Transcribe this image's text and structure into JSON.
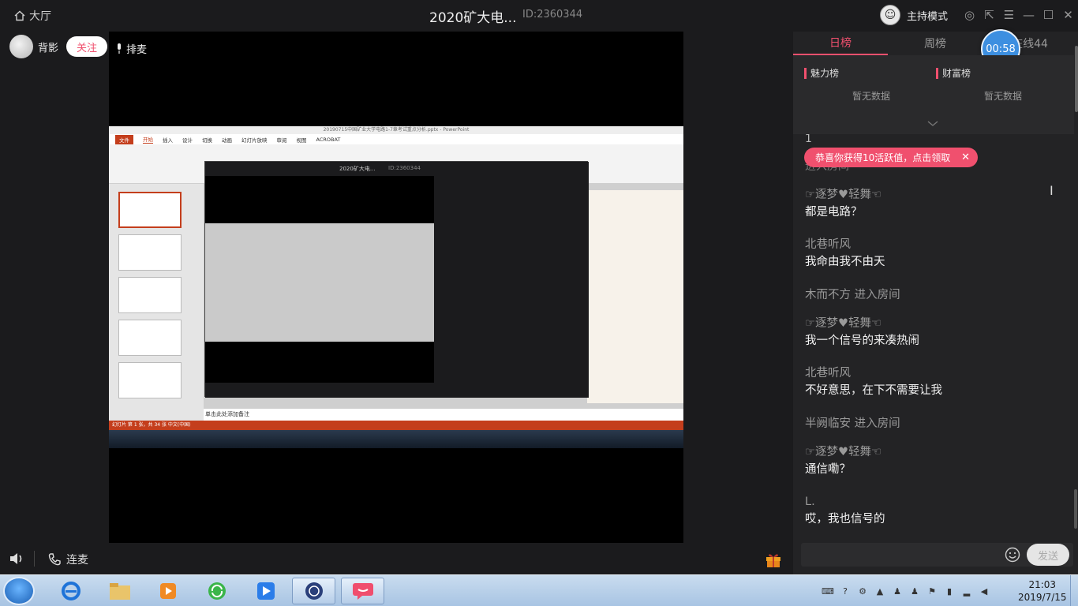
{
  "titlebar": {
    "back_label": "大厅",
    "title": "2020矿大电...",
    "room_id": "ID:2360344",
    "host_mode_label": "主持模式"
  },
  "host": {
    "name": "背影",
    "follow_label": "关注",
    "queue_label": "排麦"
  },
  "controls": {
    "lianmai_label": "连麦"
  },
  "shared_screen": {
    "ppt_title": "20190715中国矿业大学电路1-7章考试重点分析.pptx - PowerPoint",
    "menu": [
      "文件",
      "开始",
      "插入",
      "设计",
      "切换",
      "动画",
      "幻灯片放映",
      "审阅",
      "视图",
      "ACROBAT"
    ],
    "note_placeholder": "单击此处添加备注",
    "status": "幻灯片 第 1 张，共 34 张   中文(中国)",
    "mini_title": "2020矿大电...",
    "mini_id": "ID:2360344"
  },
  "right_panel": {
    "tabs": [
      "日榜",
      "周榜",
      "在线44"
    ],
    "active_tab": 0,
    "timer": "00:58",
    "charm_label": "魅力榜",
    "wealth_label": "财富榜",
    "empty_label": "暂无数据",
    "partial_top": "1",
    "partial_enter": "进入房间",
    "toast": "恭喜你获得10活跃值，点击领取",
    "messages": [
      {
        "nick": "☞逐梦♥轻舞☜",
        "text": "都是电路？"
      },
      {
        "nick": "北巷听风",
        "text": "我命由我不由天"
      },
      {
        "enter": "木而不方 进入房间"
      },
      {
        "nick": "☞逐梦♥轻舞☜",
        "text": "我一个信号的来凑热闹"
      },
      {
        "nick": "北巷听风",
        "text": "不好意思，在下不需要让我"
      },
      {
        "enter": "半阙临安 进入房间"
      },
      {
        "nick": "☞逐梦♥轻舞☜",
        "text": "通信嘞？"
      },
      {
        "nick": "L.",
        "text": "哎，我也信号的"
      }
    ],
    "send_label": "发送"
  },
  "taskbar": {
    "time": "21:03",
    "date": "2019/7/15"
  },
  "colors": {
    "accent": "#f0506e",
    "timer": "#3d8fe0",
    "bg": "#1b1b1d"
  }
}
